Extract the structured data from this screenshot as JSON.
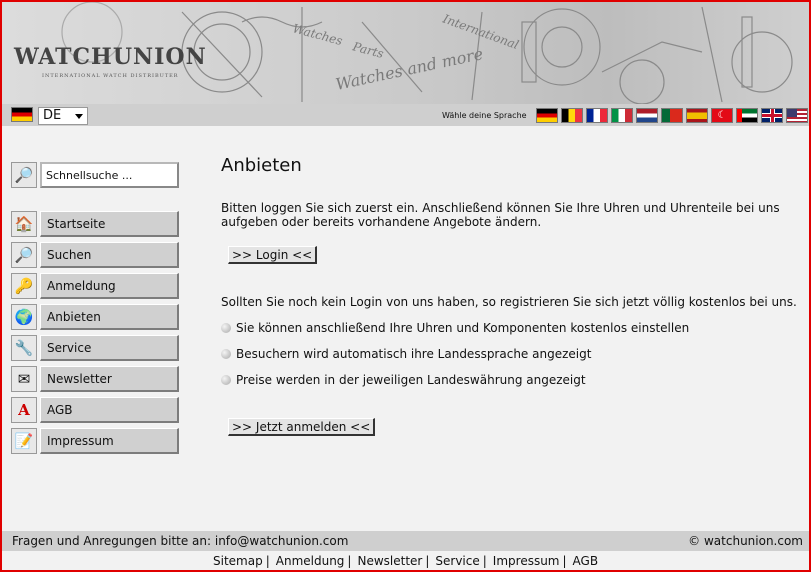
{
  "header": {
    "logo_text": "WATCHUNION",
    "logo_tagline": "INTERNATIONAL WATCH DISTRIBUTER",
    "banner_texts": [
      "Watches",
      "Parts",
      "International",
      "Watches and more"
    ]
  },
  "language": {
    "selected": "DE",
    "choose_label": "Wähle deine Sprache",
    "flags": [
      "de-flag",
      "be-flag",
      "fr-flag",
      "it-flag",
      "nl-flag",
      "pt-flag",
      "es-flag",
      "tr-flag",
      "ae-flag",
      "gb-flag",
      "us-flag"
    ]
  },
  "sidebar": {
    "quick_search_value": "Schnellsuche ...",
    "items": [
      {
        "label": "Startseite",
        "icon": "home-icon"
      },
      {
        "label": "Suchen",
        "icon": "magnifier-icon"
      },
      {
        "label": "Anmeldung",
        "icon": "user-key-icon"
      },
      {
        "label": "Anbieten",
        "icon": "globe-icon"
      },
      {
        "label": "Service",
        "icon": "tools-icon"
      },
      {
        "label": "Newsletter",
        "icon": "envelope-icon"
      },
      {
        "label": "AGB",
        "icon": "document-icon"
      },
      {
        "label": "Impressum",
        "icon": "notepad-icon"
      }
    ]
  },
  "main": {
    "title": "Anbieten",
    "intro": "Bitten loggen Sie sich zuerst ein. Anschließend können Sie Ihre Uhren und Uhrenteile bei uns aufgeben oder bereits vorhandene Angebote ändern.",
    "login_button": ">> Login <<",
    "register_text": "Sollten Sie noch kein Login von uns haben, so registrieren Sie sich jetzt völlig kostenlos bei uns.",
    "bullets": [
      "Sie können anschließend Ihre Uhren und Komponenten kostenlos einstellen",
      "Besuchern wird automatisch ihre Landessprache angezeigt",
      "Preise werden in der jeweiligen Landeswährung angezeigt"
    ],
    "register_button": ">> Jetzt anmelden <<"
  },
  "footer": {
    "contact": "Fragen und Anregungen bitte an: info@watchunion.com",
    "copyright": "© watchunion.com",
    "links": [
      "Sitemap",
      "Anmeldung",
      "Newsletter",
      "Service",
      "Impressum",
      "AGB"
    ]
  }
}
